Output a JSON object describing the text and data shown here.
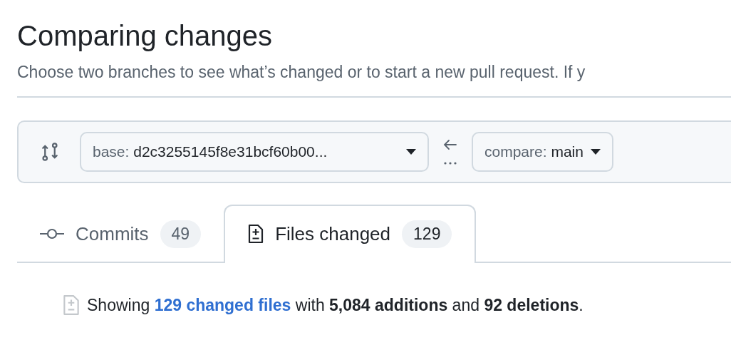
{
  "title": "Comparing changes",
  "subtitle": "Choose two branches to see what’s changed or to start a new pull request. If y",
  "range": {
    "base_label": "base:",
    "base_value": "d2c3255145f8e31bcf60b00...",
    "compare_label": "compare:",
    "compare_value": "main"
  },
  "tabs": [
    {
      "label": "Commits",
      "count": "49",
      "kind": "commit",
      "selected": false
    },
    {
      "label": "Files changed",
      "count": "129",
      "kind": "diff",
      "selected": true
    }
  ],
  "summary": {
    "prefix": "Showing ",
    "link": "129 changed files",
    "rest": " with **5,084 additions** and **92 deletions**."
  }
}
